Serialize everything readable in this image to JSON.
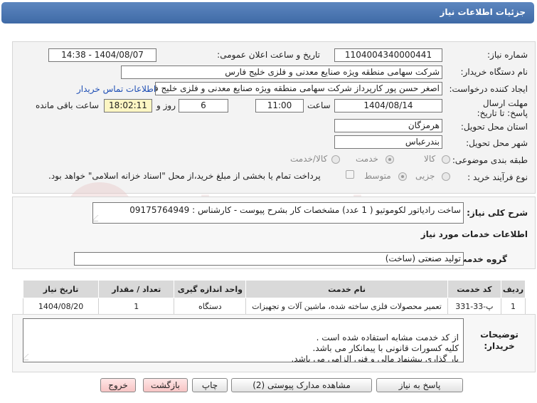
{
  "header": {
    "title": "جزئیات اطلاعات نیاز"
  },
  "form": {
    "need_number": {
      "label": "شماره نیاز:",
      "value": "1104004340000441"
    },
    "announce_datetime": {
      "label": "تاریخ و ساعت اعلان عمومی:",
      "value": "1404/08/07 - 14:38"
    },
    "buyer_org": {
      "label": "نام دستگاه خریدار:",
      "value": "شرکت سهامی منطقه ویژه صنایع معدنی و فلزی خلیج فارس"
    },
    "request_creator": {
      "label": "ایجاد کننده درخواست:",
      "value": "اصغر حسن پور کارپرداز شرکت سهامی منطقه ویژه صنایع معدنی و فلزی خلیج فارس",
      "contact_link": "اطلاعات تماس خریدار"
    },
    "deadline": {
      "label": "مهلت ارسال پاسخ: تا تاریخ:",
      "date": "1404/08/14",
      "time_label": "ساعت",
      "time": "11:00",
      "days": "6",
      "days_label": "روز و",
      "remaining": "18:02:11",
      "remaining_label": "ساعت باقی مانده"
    },
    "province": {
      "label": "استان محل تحویل:",
      "value": "هرمزگان"
    },
    "city": {
      "label": "شهر محل تحویل:",
      "value": "بندرعباس"
    },
    "category": {
      "label": "طبقه بندی موضوعی:",
      "options": [
        "کالا",
        "خدمت",
        "کالا/خدمت"
      ],
      "selected": "خدمت"
    },
    "process": {
      "label": "نوع فرآیند خرید :",
      "options": [
        "جزیی",
        "متوسط"
      ],
      "selected": "متوسط",
      "note": "پرداخت تمام یا بخشی از مبلغ خرید،از محل \"اسناد خزانه اسلامی\" خواهد بود."
    }
  },
  "summary": {
    "label": "شرح کلی نیاز:",
    "value": "ساخت رادیاتور لکوموتیو  ( 1 عدد)  مشخصات کار بشرح پیوست - کارشناس : 09175764949"
  },
  "services_section": {
    "title": "اطلاعات خدمات مورد نیاز",
    "group_label": "گروه خدمت:",
    "group_value": "تولید صنعتی (ساخت)"
  },
  "table": {
    "columns": [
      "ردیف",
      "کد خدمت",
      "نام خدمت",
      "واحد اندازه گیری",
      "تعداد / مقدار",
      "تاریخ نیاز"
    ],
    "rows": [
      [
        "1",
        "پ-33-331",
        "تعمیر محصولات فلزی ساخته شده، ماشین آلات و تجهیزات",
        "دستگاه",
        "1",
        "1404/08/20"
      ]
    ]
  },
  "buyer_notes": {
    "label": "توضیحات خریدار:",
    "value": "از کد خدمت مشابه استفاده شده است .\nکلیه کسورات قانونی با پیمانکار می باشد.\nبار گذاری پیشنهاد مالی و فنی الزامی می باشد."
  },
  "buttons": {
    "reply": "پاسخ به نیاز",
    "attachments": "مشاهده مدارک پیوستی (2)",
    "print": "چاپ",
    "back": "بازگشت",
    "exit": "خروج"
  },
  "watermark": {
    "text": "AriaTender.net"
  },
  "colors": {
    "header_bg": "#4a74b0",
    "link": "#1f4fb5",
    "countdown_bg": "#fdf6c3"
  }
}
